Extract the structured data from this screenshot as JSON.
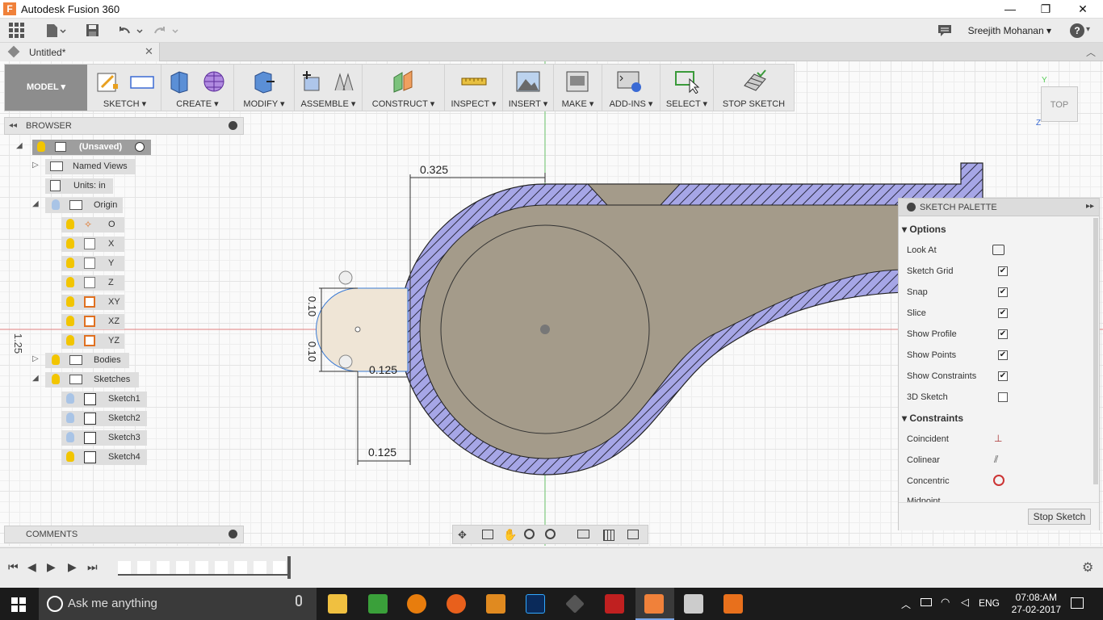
{
  "app": {
    "title": "Autodesk Fusion 360",
    "icon_letter": "F"
  },
  "window_controls": {
    "minimize": "—",
    "maximize": "❐",
    "close": "✕"
  },
  "qat": {
    "user": "Sreejith Mohanan ▾",
    "help": "?"
  },
  "document": {
    "tab_title": "Untitled*"
  },
  "toolbar": {
    "workspace": "MODEL ▾",
    "groups": [
      {
        "label": "SKETCH ▾"
      },
      {
        "label": "CREATE ▾"
      },
      {
        "label": "MODIFY ▾"
      },
      {
        "label": "ASSEMBLE ▾"
      },
      {
        "label": "CONSTRUCT ▾"
      },
      {
        "label": "INSPECT ▾"
      },
      {
        "label": "INSERT ▾"
      },
      {
        "label": "MAKE ▾"
      },
      {
        "label": "ADD-INS ▾"
      },
      {
        "label": "SELECT ▾"
      },
      {
        "label": "STOP SKETCH"
      }
    ]
  },
  "browser": {
    "title": "BROWSER",
    "items": [
      {
        "label": "(Unsaved)"
      },
      {
        "label": "Named Views"
      },
      {
        "label": "Units: in"
      },
      {
        "label": "Origin"
      },
      {
        "label": "O"
      },
      {
        "label": "X"
      },
      {
        "label": "Y"
      },
      {
        "label": "Z"
      },
      {
        "label": "XY"
      },
      {
        "label": "XZ"
      },
      {
        "label": "YZ"
      },
      {
        "label": "Bodies"
      },
      {
        "label": "Sketches"
      },
      {
        "label": "Sketch1"
      },
      {
        "label": "Sketch2"
      },
      {
        "label": "Sketch3"
      },
      {
        "label": "Sketch4"
      }
    ]
  },
  "comments": {
    "title": "COMMENTS"
  },
  "sketch": {
    "dims": {
      "top": "0.325",
      "v_upper": "0.10",
      "v_lower": "0.10",
      "mid": "0.125",
      "bottom": "0.125",
      "side": "1.25"
    }
  },
  "viewcube": {
    "face": "TOP",
    "axis_z": "Z",
    "axis_y": "Y"
  },
  "palette": {
    "title": "SKETCH PALETTE",
    "options_header": "Options",
    "options": [
      {
        "label": "Look At",
        "checked": null
      },
      {
        "label": "Sketch Grid",
        "checked": true
      },
      {
        "label": "Snap",
        "checked": true
      },
      {
        "label": "Slice",
        "checked": true
      },
      {
        "label": "Show Profile",
        "checked": true
      },
      {
        "label": "Show Points",
        "checked": true
      },
      {
        "label": "Show Constraints",
        "checked": true
      },
      {
        "label": "3D Sketch",
        "checked": false
      }
    ],
    "constraints_header": "Constraints",
    "constraints": [
      {
        "label": "Coincident"
      },
      {
        "label": "Colinear"
      },
      {
        "label": "Concentric"
      },
      {
        "label": "Midpoint"
      }
    ],
    "stop_button": "Stop Sketch"
  },
  "taskbar": {
    "search_placeholder": "Ask me anything",
    "lang": "ENG",
    "time": "07:08:AM",
    "date": "27-02-2017"
  }
}
